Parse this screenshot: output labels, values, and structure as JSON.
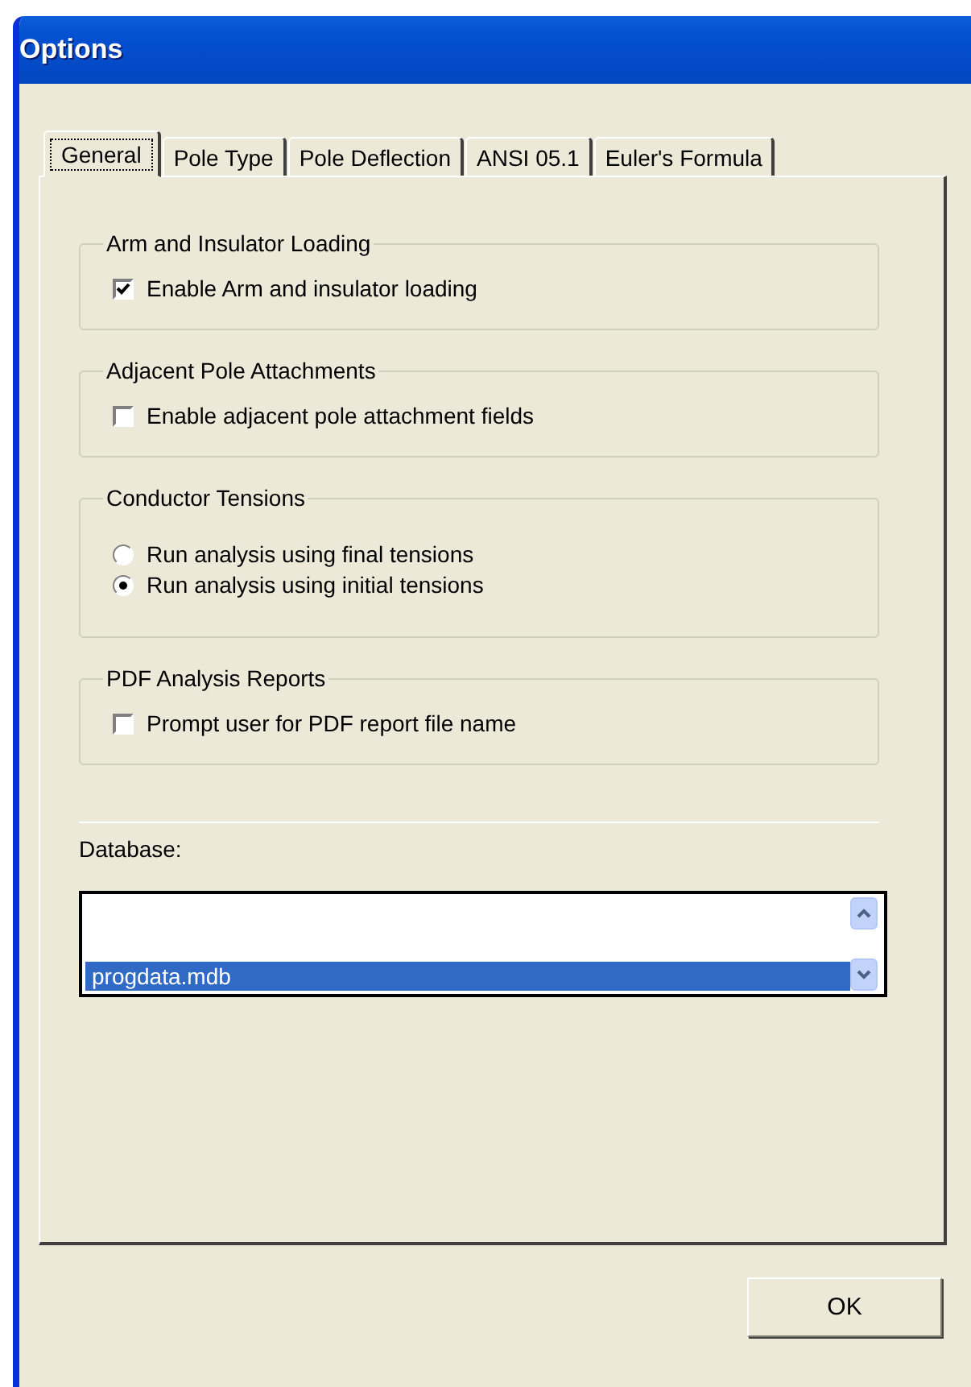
{
  "window": {
    "title": "Options"
  },
  "tabs": [
    {
      "label": "General",
      "selected": true
    },
    {
      "label": "Pole Type",
      "selected": false
    },
    {
      "label": "Pole Deflection",
      "selected": false
    },
    {
      "label": "ANSI 05.1",
      "selected": false
    },
    {
      "label": "Euler's Formula",
      "selected": false
    }
  ],
  "groups": [
    {
      "title": "Arm and Insulator Loading",
      "options": [
        {
          "kind": "checkbox",
          "label": "Enable Arm and insulator loading",
          "checked": true
        }
      ]
    },
    {
      "title": "Adjacent Pole Attachments",
      "options": [
        {
          "kind": "checkbox",
          "label": "Enable adjacent pole attachment fields",
          "checked": false
        }
      ]
    },
    {
      "title": "Conductor Tensions",
      "options": [
        {
          "kind": "radio",
          "label": "Run analysis using final tensions",
          "selected": false
        },
        {
          "kind": "radio",
          "label": "Run analysis using initial tensions",
          "selected": true
        }
      ]
    },
    {
      "title": "PDF Analysis Reports",
      "options": [
        {
          "kind": "checkbox",
          "label": "Prompt user for PDF report file name",
          "checked": false
        }
      ]
    }
  ],
  "database": {
    "label": "Database:",
    "items": [
      {
        "text": "progdata.mdb",
        "selected": true
      }
    ]
  },
  "buttons": [
    "OK"
  ]
}
